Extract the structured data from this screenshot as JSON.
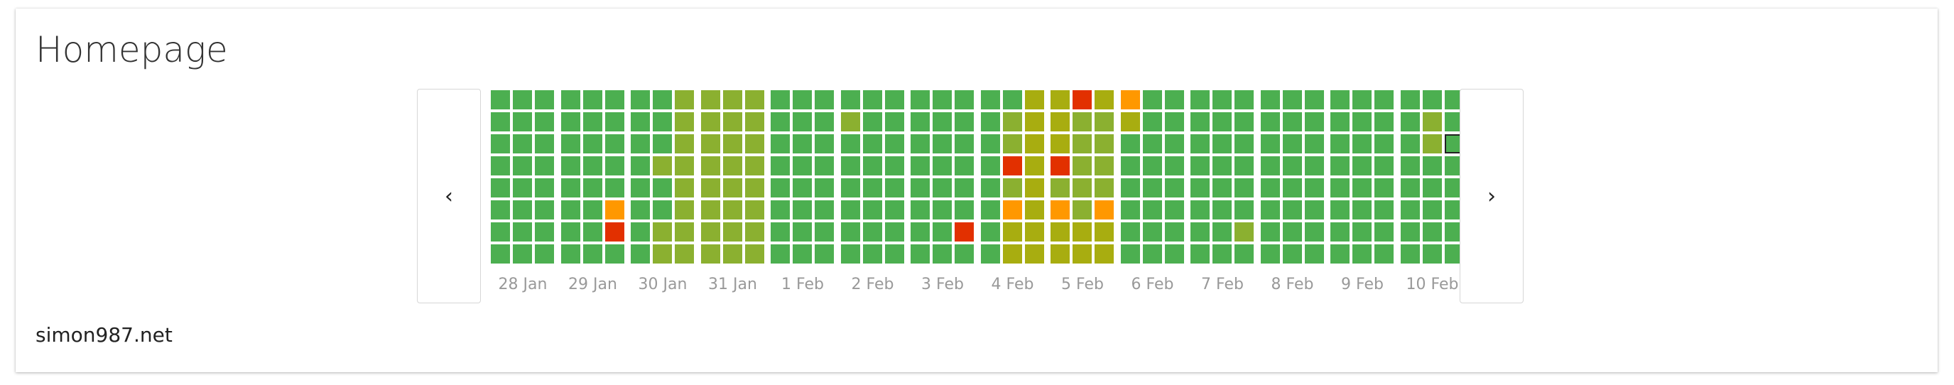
{
  "title": "Homepage",
  "site": "simon987.net",
  "nav": {
    "prev": "‹",
    "next": "›"
  },
  "colors": {
    "G": "#4caf50",
    "Y": "#8bb030",
    "O": "#a8ad10",
    "A": "#ff9800",
    "R": "#e23000"
  },
  "selected_cell": {
    "day": 13,
    "col": 2,
    "row": 2
  },
  "days": [
    {
      "label": "28 Jan",
      "cells": [
        "GGGGGGGG",
        "GGGGGGGG",
        "GGGGGGGG"
      ]
    },
    {
      "label": "29 Jan",
      "cells": [
        "GGGGGGGG",
        "GGGGGGGG",
        "GGGGGARG"
      ]
    },
    {
      "label": "30 Jan",
      "cells": [
        "GGGGGGGG",
        "GGGYGGYY",
        "YYYYYYYY"
      ]
    },
    {
      "label": "31 Jan",
      "cells": [
        "YYYYYYYY",
        "YYYYYYYY",
        "YYYYYYYY"
      ]
    },
    {
      "label": "1 Feb",
      "cells": [
        "GGGGGGGG",
        "GGGGGGGG",
        "GGGGGGGG"
      ]
    },
    {
      "label": "2 Feb",
      "cells": [
        "GYGGGGGG",
        "GGGGGGGG",
        "GGGGGGGG"
      ]
    },
    {
      "label": "3 Feb",
      "cells": [
        "GGGGGGGG",
        "GGGGGGGG",
        "GGGGGGRG"
      ]
    },
    {
      "label": "4 Feb",
      "cells": [
        "GGGGGGGG",
        "GYYRYAOO",
        "OOOOOOOO"
      ]
    },
    {
      "label": "5 Feb",
      "cells": [
        "OOORYAOO",
        "RYYYYYOO",
        "OYYYYAOO"
      ]
    },
    {
      "label": "6 Feb",
      "cells": [
        "AOGGGGGG",
        "GGGGGGGG",
        "GGGGGGGG"
      ]
    },
    {
      "label": "7 Feb",
      "cells": [
        "GGGGGGGG",
        "GGGGGGGG",
        "GGGGGGYG"
      ]
    },
    {
      "label": "8 Feb",
      "cells": [
        "GGGGGGGG",
        "GGGGGGGG",
        "GGGGGGGG"
      ]
    },
    {
      "label": "9 Feb",
      "cells": [
        "GGGGGGGG",
        "GGGGGGGG",
        "GGGGGGGG"
      ]
    },
    {
      "label": "10 Feb",
      "cells": [
        "GGGGGGGG",
        "GYYGGGGG",
        "GGGGGGGG"
      ]
    }
  ]
}
